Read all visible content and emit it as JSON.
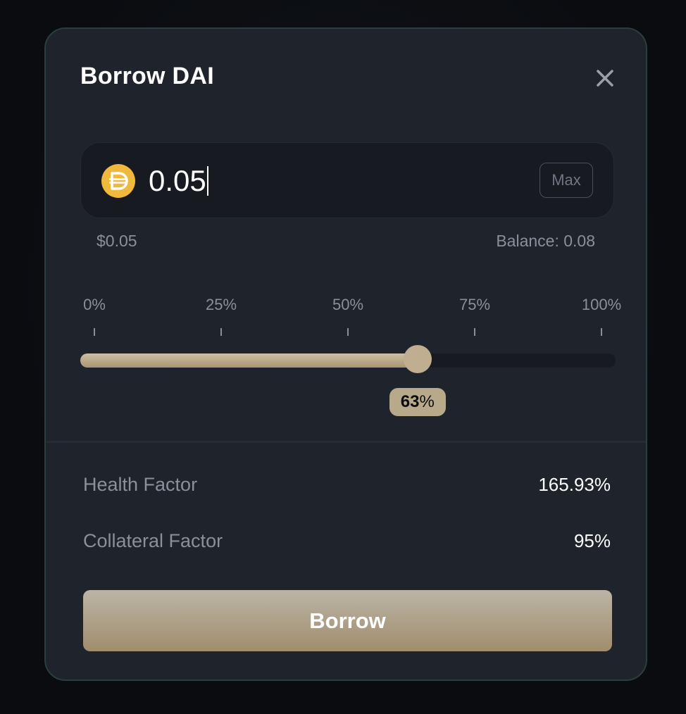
{
  "modal": {
    "title": "Borrow DAI",
    "close_icon": "close-icon"
  },
  "amount": {
    "token_icon": "dai-icon",
    "token_color": "#f0b93b",
    "value": "0.05",
    "max_label": "Max",
    "usd_value": "$0.05",
    "balance_label": "Balance: 0.08"
  },
  "slider": {
    "ticks": [
      "0%",
      "25%",
      "50%",
      "75%",
      "100%"
    ],
    "value_fraction": 0.63,
    "value_number": "63",
    "value_suffix": "%"
  },
  "details": {
    "health_factor_label": "Health Factor",
    "health_factor_value": "165.93%",
    "collateral_factor_label": "Collateral Factor",
    "collateral_factor_value": "95%"
  },
  "actions": {
    "borrow_label": "Borrow"
  },
  "colors": {
    "accent": "#b9a98b",
    "surface": "#1f232b",
    "border": "#2a3f3c"
  }
}
